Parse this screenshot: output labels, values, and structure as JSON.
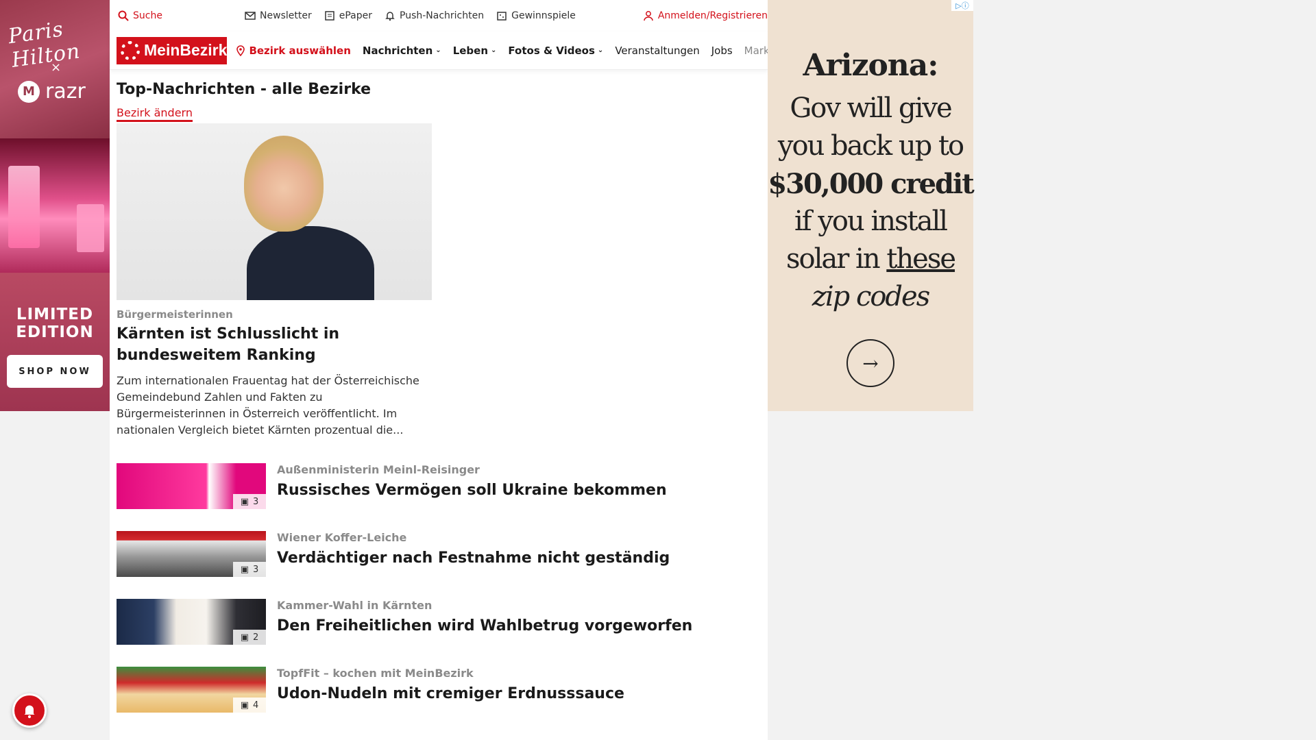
{
  "left_ad": {
    "brand_script": "Paris Hilton",
    "x": "×",
    "brand2": "razr",
    "headline": "LIMITED EDITION",
    "cta": "SHOP NOW",
    "adchoice": "▷ⓘ"
  },
  "topbar": {
    "search": "Suche",
    "newsletter": "Newsletter",
    "epaper": "ePaper",
    "push": "Push-Nachrichten",
    "contests": "Gewinnspiele",
    "login": "Anmelden/Registrieren"
  },
  "navbar": {
    "logo": "MeinBezirk",
    "select_district": "Bezirk auswählen",
    "items": [
      "Nachrichten",
      "Leben",
      "Fotos & Videos",
      "Veranstaltungen",
      "Jobs",
      "Marktplatz"
    ]
  },
  "section": {
    "title": "Top-Nachrichten - alle Bezirke",
    "change_link": "Bezirk ändern"
  },
  "hero": {
    "kicker": "Bürgermeisterinnen",
    "title": "Kärnten ist Schlusslicht in bundesweitem Ranking",
    "text": "Zum internationalen Frauentag hat der Österreichische Gemeindebund Zahlen und Fakten zu Bürgermeisterinnen in Österreich veröffentlicht. Im nationalen Vergleich bietet Kärnten prozentual die..."
  },
  "articles": [
    {
      "kicker": "Außenministerin Meinl-Reisinger",
      "title": "Russisches Vermögen soll Ukraine bekommen",
      "images": "3"
    },
    {
      "kicker": "Wiener Koffer-Leiche",
      "title": "Verdächtiger nach Festnahme nicht geständig",
      "images": "3"
    },
    {
      "kicker": "Kammer-Wahl in Kärnten",
      "title": "Den Freiheitlichen wird Wahlbetrug vorgeworfen",
      "images": "2"
    },
    {
      "kicker": "TopfFit – kochen mit MeinBezirk",
      "title": "Udon-Nudeln mit cremiger Erdnusssauce",
      "images": "4"
    }
  ],
  "right_ad": {
    "headline": "Arizona:",
    "line1": "Gov will give",
    "line2": "you back up to",
    "line3": "$30,000 credit",
    "line4": "if you install",
    "line5a": "solar in ",
    "line5b": "these",
    "line6": "zip codes",
    "arrow": "→",
    "adchoice": "▷ⓘ"
  },
  "colors": {
    "brand_red": "#d3111b",
    "ad_bg": "#efe1d1"
  },
  "icons": [
    "search-icon",
    "mail-icon",
    "newspaper-icon",
    "bell-icon",
    "gift-icon",
    "user-icon",
    "location-pin-icon",
    "chevron-down-icon",
    "gallery-icon",
    "arrow-right-icon"
  ]
}
